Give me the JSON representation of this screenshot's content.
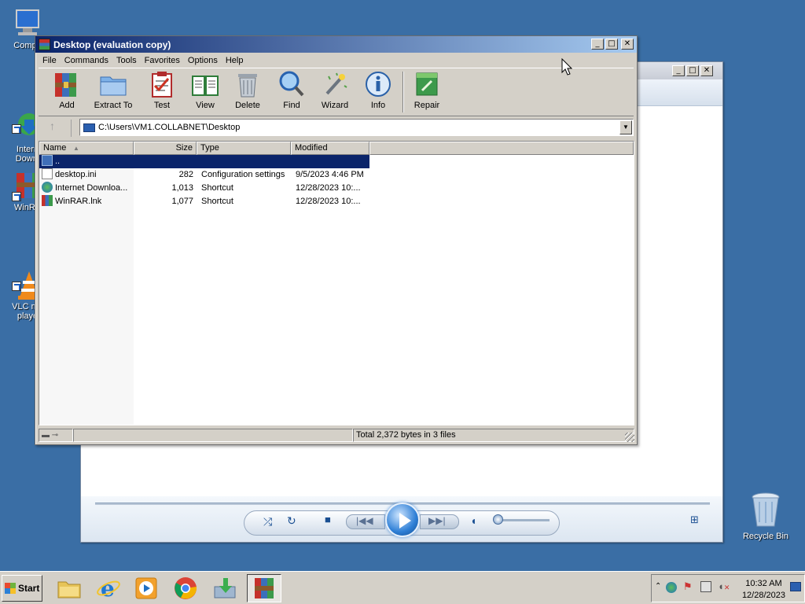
{
  "desktop": {
    "icons": [
      {
        "label": "Compu"
      },
      {
        "label": "Intern\nDownl"
      },
      {
        "label": "WinRA"
      },
      {
        "label": "VLC me\nplaye"
      }
    ],
    "recycle_bin": "Recycle Bin"
  },
  "winrar": {
    "title": "Desktop (evaluation copy)",
    "menu": [
      "File",
      "Commands",
      "Tools",
      "Favorites",
      "Options",
      "Help"
    ],
    "toolbar": {
      "add": "Add",
      "extract_to": "Extract To",
      "test": "Test",
      "view": "View",
      "delete": "Delete",
      "find": "Find",
      "wizard": "Wizard",
      "info": "Info",
      "repair": "Repair"
    },
    "path": "C:\\Users\\VM1.COLLABNET\\Desktop",
    "columns": [
      "Name",
      "Size",
      "Type",
      "Modified"
    ],
    "rows": [
      {
        "name": "..",
        "size": "",
        "type": "",
        "modified": ""
      },
      {
        "name": "desktop.ini",
        "size": "282",
        "type": "Configuration settings",
        "modified": "9/5/2023 4:46 PM"
      },
      {
        "name": "Internet Downloa...",
        "size": "1,013",
        "type": "Shortcut",
        "modified": "12/28/2023 10:..."
      },
      {
        "name": "WinRAR.lnk",
        "size": "1,077",
        "type": "Shortcut",
        "modified": "12/28/2023 10:..."
      }
    ],
    "status": "Total 2,372 bytes in 3 files"
  },
  "taskbar": {
    "start_label": "Start",
    "time": "10:32 AM",
    "date": "12/28/2023"
  }
}
